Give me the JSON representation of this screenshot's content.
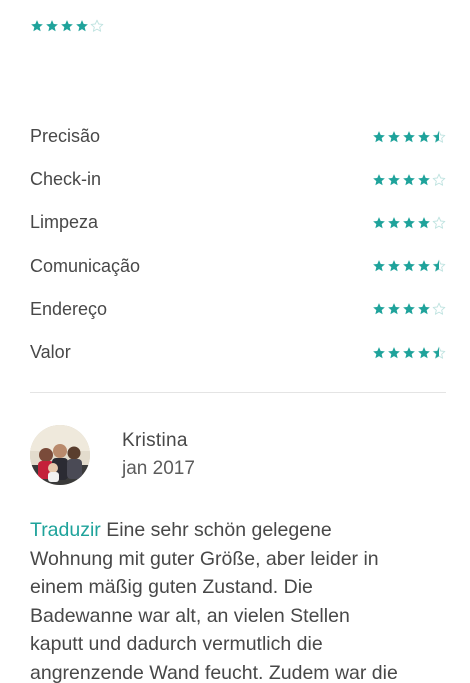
{
  "overall_rating": {
    "value": 4,
    "max": 5
  },
  "categories": [
    {
      "label": "Precisão",
      "rating": 4.5
    },
    {
      "label": "Check-in",
      "rating": 4
    },
    {
      "label": "Limpeza",
      "rating": 4
    },
    {
      "label": "Comunicação",
      "rating": 4.5
    },
    {
      "label": "Endereço",
      "rating": 4
    },
    {
      "label": "Valor",
      "rating": 4.5
    }
  ],
  "review": {
    "reviewer_name": "Kristina",
    "date": "jan 2017",
    "translate_label": "Traduzir",
    "text_lines": [
      "Eine sehr schön gelegene",
      "Wohnung mit guter Größe, aber leider in",
      "einem mäßig guten Zustand. Die",
      "Badewanne war alt, an vielen Stellen",
      "kaputt und dadurch vermutlich die",
      "angrenzende Wand feucht. Zudem war die"
    ]
  },
  "colors": {
    "star_filled": "#1fa39b",
    "star_empty": "#bfe3e0",
    "link": "#1fa39b",
    "divider": "#e4e4e4"
  },
  "icons": {
    "star": "star-icon",
    "half_star": "star-half-icon",
    "empty_star": "star-empty-icon"
  }
}
